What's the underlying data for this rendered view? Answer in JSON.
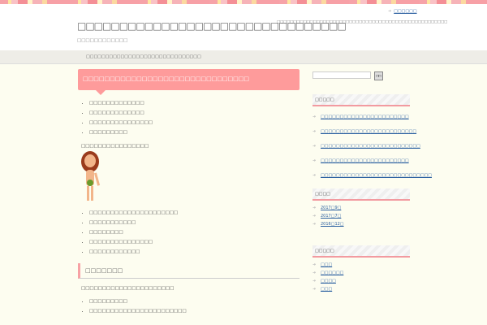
{
  "header": {
    "top_link": "□□□□□□",
    "title": "□□□□□□□□□□□□□□□□□□□□□□□□□□□□□□□□",
    "subtitle": "□□□□□□□□□□□□",
    "description": "□□□□□□□□□□□□□□□□□□□□□□□□□□□□□□□□□□□□□□□□□□□□□□□□□□□□"
  },
  "nav": {
    "breadcrumb": "□□□□□□□□□□□□□□□□□□□□□□□□□□□□□□"
  },
  "post": {
    "title": "□□□□□□□□□□□□□□□□□□□□□□□□□□□□□□□",
    "list1": [
      "□□□□□□□□□□□□□",
      "□□□□□□□□□□□□□",
      "□□□□□□□□□□□□□□□",
      "□□□□□□□□□"
    ],
    "para1": "□□□□□□□□□□□□□□□□",
    "list2": [
      "□□□□□□□□□□□□□□□□□□□□□",
      "□□□□□□□□□□□",
      "□□□□□□□□",
      "□□□□□□□□□□□□□□□",
      "□□□□□□□□□□□□"
    ],
    "heading2": "□□□□□□□",
    "para2": "□□□□□□□□□□□□□□□□□□□□□□",
    "list3": [
      "□□□□□□□□□",
      "□□□□□□□□□□□□□□□□□□□□□□□"
    ]
  },
  "sidebar": {
    "search_button": "□□",
    "recent": {
      "heading": "□□□□□",
      "items": [
        "□□□□□□□□□□□□□□□□□□□□□□□",
        "□□□□□□□□□□□□□□□□□□□□□□□□□",
        "□□□□□□□□□□□□□□□□□□□□□□□□□□",
        "□□□□□□□□□□□□□□□□□□□□□□□",
        "□□□□□□□□□□□□□□□□□□□□□□□□□□□□□"
      ]
    },
    "archives": {
      "heading": "□□□□",
      "items": [
        "2017□9□",
        "2017□7□",
        "2016□12□"
      ]
    },
    "categories": {
      "heading": "□□□□□",
      "items": [
        "□□□",
        "□□□□□□",
        "□□□□",
        "□□□"
      ]
    }
  }
}
